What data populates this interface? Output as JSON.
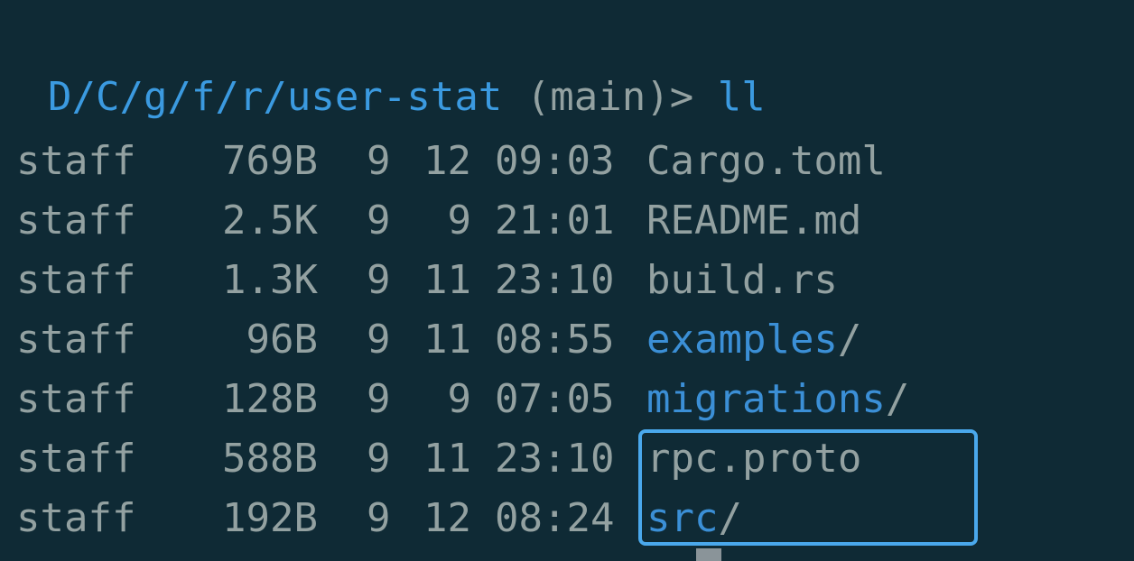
{
  "prompt": {
    "path": "D/C/g/f/r/user-stat",
    "branch": "(main)>",
    "command": "ll"
  },
  "listing": [
    {
      "group": "staff",
      "size": "769B",
      "month": "9",
      "day": "12",
      "time": "09:03",
      "name": "Cargo.toml",
      "is_dir": false
    },
    {
      "group": "staff",
      "size": "2.5K",
      "month": "9",
      "day": "9",
      "time": "21:01",
      "name": "README.md",
      "is_dir": false
    },
    {
      "group": "staff",
      "size": "1.3K",
      "month": "9",
      "day": "11",
      "time": "23:10",
      "name": "build.rs",
      "is_dir": false
    },
    {
      "group": "staff",
      "size": "96B",
      "month": "9",
      "day": "11",
      "time": "08:55",
      "name": "examples",
      "is_dir": true
    },
    {
      "group": "staff",
      "size": "128B",
      "month": "9",
      "day": "9",
      "time": "07:05",
      "name": "migrations",
      "is_dir": true
    },
    {
      "group": "staff",
      "size": "588B",
      "month": "9",
      "day": "11",
      "time": "23:10",
      "name": "rpc.proto",
      "is_dir": false
    },
    {
      "group": "staff",
      "size": "192B",
      "month": "9",
      "day": "12",
      "time": "08:24",
      "name": "src",
      "is_dir": true
    }
  ],
  "dir_suffix": "/",
  "colors": {
    "background": "#0f2a35",
    "text": "#93a1a1",
    "accent_blue": "#3b9ae0",
    "selection_border": "#4aa8ec"
  }
}
